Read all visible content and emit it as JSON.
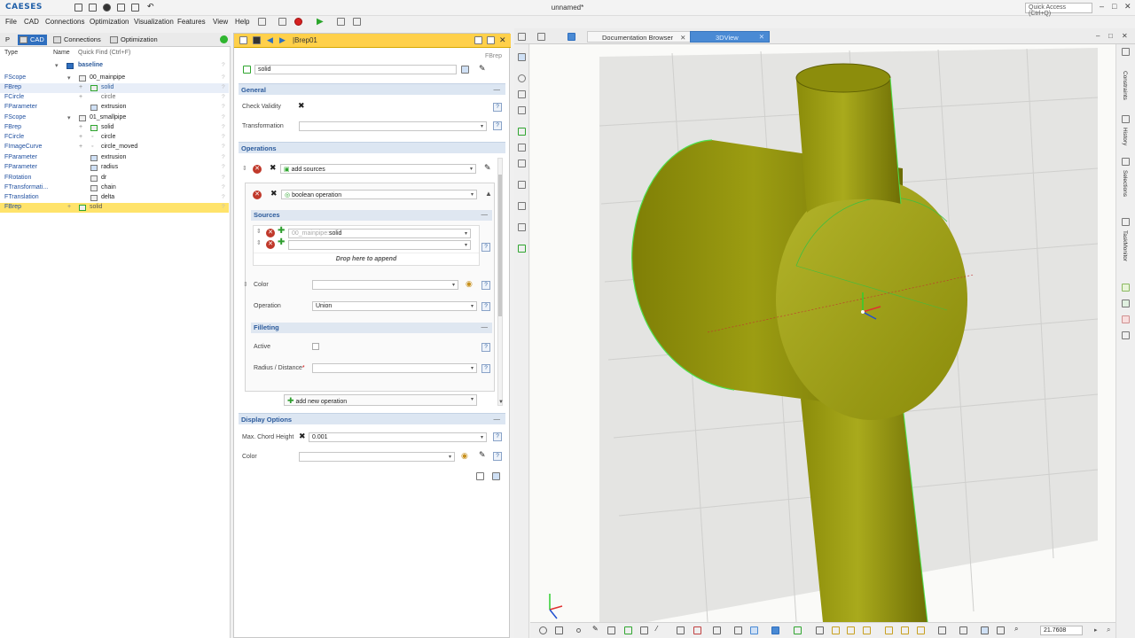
{
  "app": {
    "logo": "CAESES",
    "window_title": "unnamed*",
    "quick_access_placeholder": "Quick Access (Ctrl+Q)"
  },
  "menu": [
    "File",
    "CAD",
    "Connections",
    "Optimization",
    "Visualization",
    "Features",
    "View",
    "Help"
  ],
  "left_panel": {
    "tabs": [
      "CAD",
      "Connections",
      "Optimization"
    ],
    "col_type": "Type",
    "col_name": "Name",
    "quick_find": "Quick Find (Ctrl+F)",
    "rows": [
      {
        "type": "",
        "name": "baseline"
      },
      {
        "type": "FScope",
        "name": "00_mainpipe"
      },
      {
        "type": "FBrep",
        "name": "solid"
      },
      {
        "type": "FCircle",
        "name": "circle"
      },
      {
        "type": "FParameter",
        "name": "extrusion"
      },
      {
        "type": "FScope",
        "name": "01_smallpipe"
      },
      {
        "type": "FBrep",
        "name": "solid"
      },
      {
        "type": "FCircle",
        "name": "circle"
      },
      {
        "type": "FImageCurve",
        "name": "circle_moved"
      },
      {
        "type": "FParameter",
        "name": "extrusion"
      },
      {
        "type": "FParameter",
        "name": "radius"
      },
      {
        "type": "FRotation",
        "name": "dr"
      },
      {
        "type": "FTransformati...",
        "name": "chain"
      },
      {
        "type": "FTranslation",
        "name": "delta"
      },
      {
        "type": "FBrep",
        "name": "solid"
      }
    ]
  },
  "mid_panel": {
    "title": "|Brep01",
    "type_label": "FBrep",
    "name_value": "solid",
    "general": {
      "header": "General",
      "check_validity": "Check Validity",
      "transformation": "Transformation"
    },
    "operations": {
      "header": "Operations",
      "add_sources": "add sources",
      "boolean_operation": "boolean operation",
      "sources_header": "Sources",
      "source_prefix": "00_mainpipe:",
      "source_value": "solid",
      "drop_hint": "Drop here to append",
      "color_label": "Color",
      "operation_label": "Operation",
      "operation_value": "Union",
      "filleting_header": "Filleting",
      "active_label": "Active",
      "radius_label": "Radius / Distance",
      "radius_required": "*",
      "add_new_operation": "add new operation"
    },
    "display_options": {
      "header": "Display Options",
      "max_chord_height_label": "Max. Chord Height",
      "max_chord_height_value": "0.001",
      "color_label": "Color"
    }
  },
  "view": {
    "tabs": [
      "Documentation Browser",
      "3DView"
    ],
    "right_tools": [
      "Constraints",
      "History",
      "Selections",
      "TaskMonitor"
    ],
    "zoom_value": "21.7608"
  },
  "colors": {
    "accent": "#2f6fbf",
    "selection": "#ffe36b",
    "header_yellow": "#ffd04a",
    "solid_body": "#9ea00f",
    "edge_highlight": "#4ee04e"
  }
}
